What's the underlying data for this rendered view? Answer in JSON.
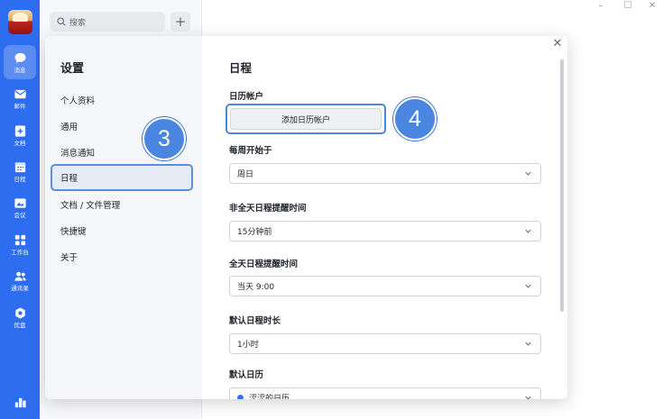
{
  "sidebar": {
    "items": [
      {
        "label": "消息",
        "icon": "chat-icon"
      },
      {
        "label": "邮件",
        "icon": "mail-icon"
      },
      {
        "label": "文档",
        "icon": "doc-icon"
      },
      {
        "label": "日程",
        "icon": "calendar-icon"
      },
      {
        "label": "会议",
        "icon": "video-icon"
      },
      {
        "label": "工作台",
        "icon": "grid-icon"
      },
      {
        "label": "通讯录",
        "icon": "contacts-icon"
      },
      {
        "label": "优盘",
        "icon": "cloud-drive-icon"
      }
    ],
    "bottom_icon": "apps-icon",
    "accent": "#2f6df0"
  },
  "search": {
    "placeholder": "搜索"
  },
  "dialog": {
    "title": "设置",
    "nav": [
      "个人资料",
      "通用",
      "消息通知",
      "日程",
      "文档 / 文件管理",
      "快捷键",
      "关于"
    ],
    "active_nav": "日程",
    "panel": {
      "title": "日程",
      "calendar_account_label": "日历帐户",
      "add_calendar_button": "添加日历帐户",
      "week_start_label": "每周开始于",
      "week_start_value": "周日",
      "non_allday_reminder_label": "非全天日程提醒时间",
      "non_allday_reminder_value": "15分钟前",
      "allday_reminder_label": "全天日程提醒时间",
      "allday_reminder_value": "当天 9:00",
      "default_duration_label": "默认日程时长",
      "default_duration_value": "1小时",
      "default_calendar_label": "默认日历",
      "default_calendar_value": "涩涩的日历"
    }
  },
  "annotations": {
    "badge_3": "3",
    "badge_4": "4"
  }
}
